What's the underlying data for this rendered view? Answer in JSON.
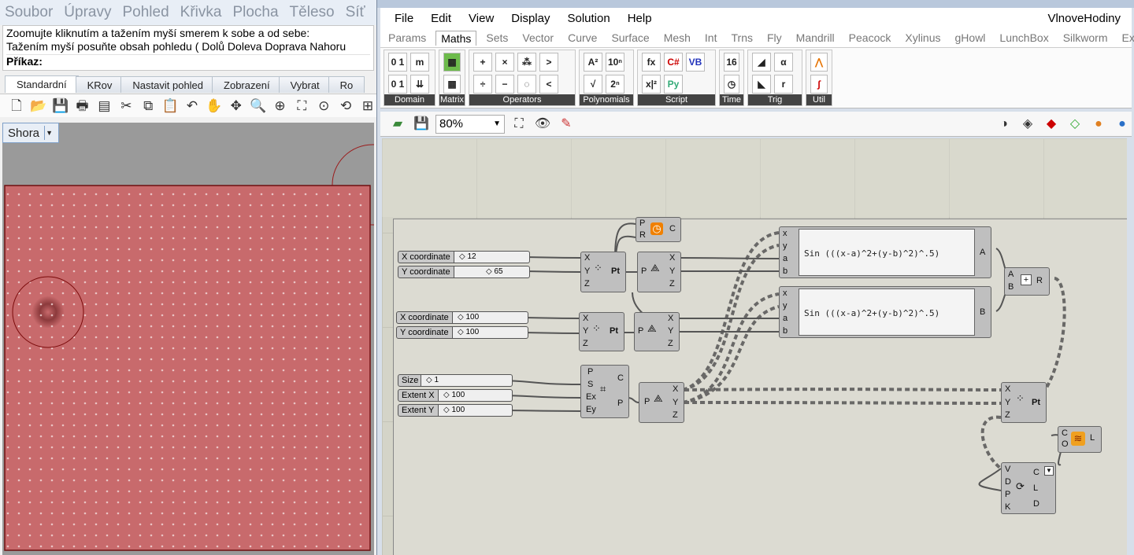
{
  "rhino": {
    "menu": [
      "Soubor",
      "Úpravy",
      "Pohled",
      "Křivka",
      "Plocha",
      "Těleso",
      "Síť",
      "K"
    ],
    "command_lines": [
      "Zoomujte kliknutím a tažením myší smerem k sobe a od sebe:",
      "Tažením myší posuňte obsah pohledu ( Dolů  Doleva  Doprava  Nahoru"
    ],
    "prompt": "Příkaz:",
    "tabs": [
      "Standardní",
      "KRov",
      "Nastavit pohled",
      "Zobrazení",
      "Vybrat",
      "Ro"
    ],
    "viewport_label": "Shora"
  },
  "gh": {
    "menu": [
      "File",
      "Edit",
      "View",
      "Display",
      "Solution",
      "Help"
    ],
    "document_name": "VlnoveHodiny",
    "tabs": [
      "Params",
      "Maths",
      "Sets",
      "Vector",
      "Curve",
      "Surface",
      "Mesh",
      "Int",
      "Trns",
      "Fly",
      "Mandrill",
      "Peacock",
      "Xylinus",
      "gHowl",
      "LunchBox",
      "Silkworm",
      "Extra"
    ],
    "active_tab": "Maths",
    "ribbon_groups": [
      "Domain",
      "Matrix",
      "Operators",
      "Polynomials",
      "Script",
      "Time",
      "Trig",
      "Util"
    ],
    "zoom": "80%",
    "sliders": [
      {
        "name": "X coordinate",
        "value": "12"
      },
      {
        "name": "Y coordinate",
        "value": "65"
      },
      {
        "name": "X coordinate",
        "value": "100"
      },
      {
        "name": "Y coordinate",
        "value": "100"
      },
      {
        "name": "Size",
        "value": "1"
      },
      {
        "name": "Extent X",
        "value": "100"
      },
      {
        "name": "Extent Y",
        "value": "100"
      }
    ],
    "expressions": [
      "Sin (((x-a)^2+(y-b)^2)^.5)",
      "Sin (((x-a)^2+(y-b)^2)^.5)"
    ],
    "expr_outputs": [
      "A",
      "B"
    ]
  },
  "colors": {
    "wave_base": "#b85c5e",
    "wire": "#555555",
    "accent": "#4f81bd"
  }
}
